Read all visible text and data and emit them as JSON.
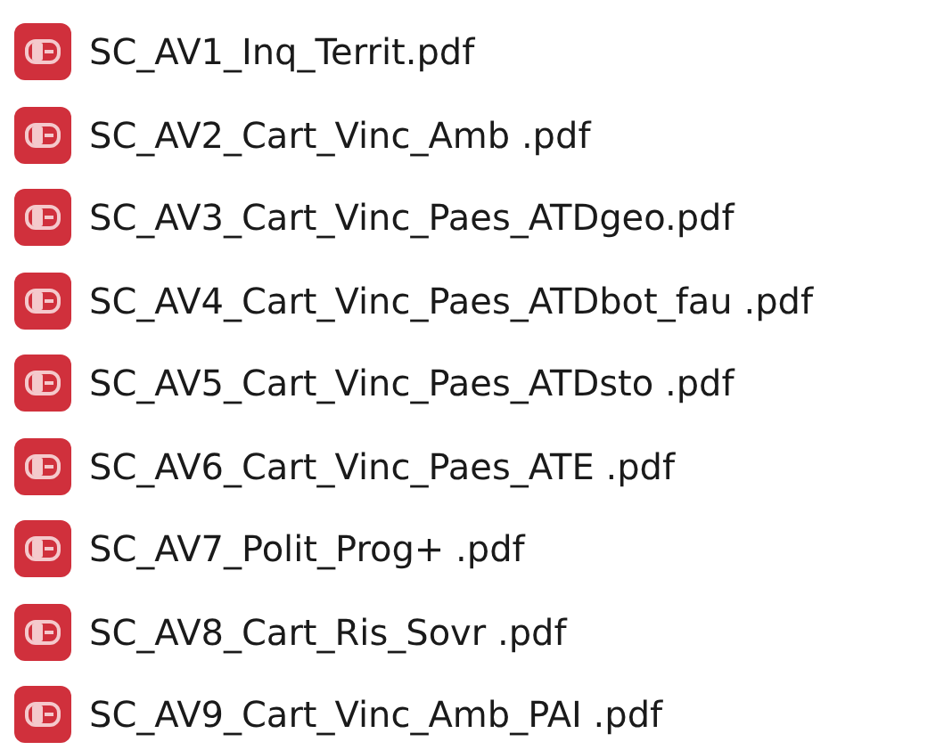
{
  "files": [
    {
      "name": "SC_AV1_Inq_Territ.pdf",
      "kind": "pdf"
    },
    {
      "name": "SC_AV2_Cart_Vinc_Amb .pdf",
      "kind": "pdf"
    },
    {
      "name": "SC_AV3_Cart_Vinc_Paes_ATDgeo.pdf",
      "kind": "pdf"
    },
    {
      "name": "SC_AV4_Cart_Vinc_Paes_ATDbot_fau .pdf",
      "kind": "pdf"
    },
    {
      "name": "SC_AV5_Cart_Vinc_Paes_ATDsto .pdf",
      "kind": "pdf"
    },
    {
      "name": "SC_AV6_Cart_Vinc_Paes_ATE .pdf",
      "kind": "pdf"
    },
    {
      "name": "SC_AV7_Polit_Prog+ .pdf",
      "kind": "pdf"
    },
    {
      "name": "SC_AV8_Cart_Ris_Sovr .pdf",
      "kind": "pdf"
    },
    {
      "name": "SC_AV9_Cart_Vinc_Amb_PAI .pdf",
      "kind": "pdf"
    }
  ]
}
